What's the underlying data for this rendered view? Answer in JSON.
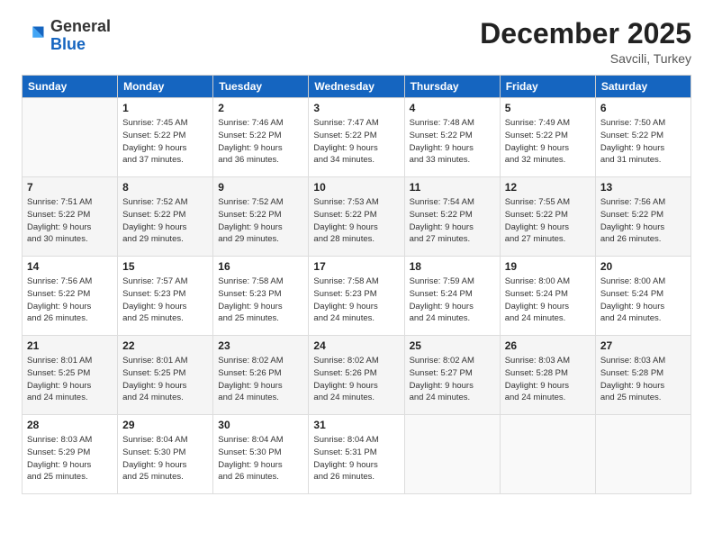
{
  "logo": {
    "general": "General",
    "blue": "Blue"
  },
  "header": {
    "month": "December 2025",
    "location": "Savcili, Turkey"
  },
  "days_of_week": [
    "Sunday",
    "Monday",
    "Tuesday",
    "Wednesday",
    "Thursday",
    "Friday",
    "Saturday"
  ],
  "weeks": [
    [
      {
        "day": "",
        "sunrise": "",
        "sunset": "",
        "daylight": ""
      },
      {
        "day": "1",
        "sunrise": "Sunrise: 7:45 AM",
        "sunset": "Sunset: 5:22 PM",
        "daylight": "Daylight: 9 hours and 37 minutes."
      },
      {
        "day": "2",
        "sunrise": "Sunrise: 7:46 AM",
        "sunset": "Sunset: 5:22 PM",
        "daylight": "Daylight: 9 hours and 36 minutes."
      },
      {
        "day": "3",
        "sunrise": "Sunrise: 7:47 AM",
        "sunset": "Sunset: 5:22 PM",
        "daylight": "Daylight: 9 hours and 34 minutes."
      },
      {
        "day": "4",
        "sunrise": "Sunrise: 7:48 AM",
        "sunset": "Sunset: 5:22 PM",
        "daylight": "Daylight: 9 hours and 33 minutes."
      },
      {
        "day": "5",
        "sunrise": "Sunrise: 7:49 AM",
        "sunset": "Sunset: 5:22 PM",
        "daylight": "Daylight: 9 hours and 32 minutes."
      },
      {
        "day": "6",
        "sunrise": "Sunrise: 7:50 AM",
        "sunset": "Sunset: 5:22 PM",
        "daylight": "Daylight: 9 hours and 31 minutes."
      }
    ],
    [
      {
        "day": "7",
        "sunrise": "Sunrise: 7:51 AM",
        "sunset": "Sunset: 5:22 PM",
        "daylight": "Daylight: 9 hours and 30 minutes."
      },
      {
        "day": "8",
        "sunrise": "Sunrise: 7:52 AM",
        "sunset": "Sunset: 5:22 PM",
        "daylight": "Daylight: 9 hours and 29 minutes."
      },
      {
        "day": "9",
        "sunrise": "Sunrise: 7:52 AM",
        "sunset": "Sunset: 5:22 PM",
        "daylight": "Daylight: 9 hours and 29 minutes."
      },
      {
        "day": "10",
        "sunrise": "Sunrise: 7:53 AM",
        "sunset": "Sunset: 5:22 PM",
        "daylight": "Daylight: 9 hours and 28 minutes."
      },
      {
        "day": "11",
        "sunrise": "Sunrise: 7:54 AM",
        "sunset": "Sunset: 5:22 PM",
        "daylight": "Daylight: 9 hours and 27 minutes."
      },
      {
        "day": "12",
        "sunrise": "Sunrise: 7:55 AM",
        "sunset": "Sunset: 5:22 PM",
        "daylight": "Daylight: 9 hours and 27 minutes."
      },
      {
        "day": "13",
        "sunrise": "Sunrise: 7:56 AM",
        "sunset": "Sunset: 5:22 PM",
        "daylight": "Daylight: 9 hours and 26 minutes."
      }
    ],
    [
      {
        "day": "14",
        "sunrise": "Sunrise: 7:56 AM",
        "sunset": "Sunset: 5:22 PM",
        "daylight": "Daylight: 9 hours and 26 minutes."
      },
      {
        "day": "15",
        "sunrise": "Sunrise: 7:57 AM",
        "sunset": "Sunset: 5:23 PM",
        "daylight": "Daylight: 9 hours and 25 minutes."
      },
      {
        "day": "16",
        "sunrise": "Sunrise: 7:58 AM",
        "sunset": "Sunset: 5:23 PM",
        "daylight": "Daylight: 9 hours and 25 minutes."
      },
      {
        "day": "17",
        "sunrise": "Sunrise: 7:58 AM",
        "sunset": "Sunset: 5:23 PM",
        "daylight": "Daylight: 9 hours and 24 minutes."
      },
      {
        "day": "18",
        "sunrise": "Sunrise: 7:59 AM",
        "sunset": "Sunset: 5:24 PM",
        "daylight": "Daylight: 9 hours and 24 minutes."
      },
      {
        "day": "19",
        "sunrise": "Sunrise: 8:00 AM",
        "sunset": "Sunset: 5:24 PM",
        "daylight": "Daylight: 9 hours and 24 minutes."
      },
      {
        "day": "20",
        "sunrise": "Sunrise: 8:00 AM",
        "sunset": "Sunset: 5:24 PM",
        "daylight": "Daylight: 9 hours and 24 minutes."
      }
    ],
    [
      {
        "day": "21",
        "sunrise": "Sunrise: 8:01 AM",
        "sunset": "Sunset: 5:25 PM",
        "daylight": "Daylight: 9 hours and 24 minutes."
      },
      {
        "day": "22",
        "sunrise": "Sunrise: 8:01 AM",
        "sunset": "Sunset: 5:25 PM",
        "daylight": "Daylight: 9 hours and 24 minutes."
      },
      {
        "day": "23",
        "sunrise": "Sunrise: 8:02 AM",
        "sunset": "Sunset: 5:26 PM",
        "daylight": "Daylight: 9 hours and 24 minutes."
      },
      {
        "day": "24",
        "sunrise": "Sunrise: 8:02 AM",
        "sunset": "Sunset: 5:26 PM",
        "daylight": "Daylight: 9 hours and 24 minutes."
      },
      {
        "day": "25",
        "sunrise": "Sunrise: 8:02 AM",
        "sunset": "Sunset: 5:27 PM",
        "daylight": "Daylight: 9 hours and 24 minutes."
      },
      {
        "day": "26",
        "sunrise": "Sunrise: 8:03 AM",
        "sunset": "Sunset: 5:28 PM",
        "daylight": "Daylight: 9 hours and 24 minutes."
      },
      {
        "day": "27",
        "sunrise": "Sunrise: 8:03 AM",
        "sunset": "Sunset: 5:28 PM",
        "daylight": "Daylight: 9 hours and 25 minutes."
      }
    ],
    [
      {
        "day": "28",
        "sunrise": "Sunrise: 8:03 AM",
        "sunset": "Sunset: 5:29 PM",
        "daylight": "Daylight: 9 hours and 25 minutes."
      },
      {
        "day": "29",
        "sunrise": "Sunrise: 8:04 AM",
        "sunset": "Sunset: 5:30 PM",
        "daylight": "Daylight: 9 hours and 25 minutes."
      },
      {
        "day": "30",
        "sunrise": "Sunrise: 8:04 AM",
        "sunset": "Sunset: 5:30 PM",
        "daylight": "Daylight: 9 hours and 26 minutes."
      },
      {
        "day": "31",
        "sunrise": "Sunrise: 8:04 AM",
        "sunset": "Sunset: 5:31 PM",
        "daylight": "Daylight: 9 hours and 26 minutes."
      },
      {
        "day": "",
        "sunrise": "",
        "sunset": "",
        "daylight": ""
      },
      {
        "day": "",
        "sunrise": "",
        "sunset": "",
        "daylight": ""
      },
      {
        "day": "",
        "sunrise": "",
        "sunset": "",
        "daylight": ""
      }
    ]
  ]
}
